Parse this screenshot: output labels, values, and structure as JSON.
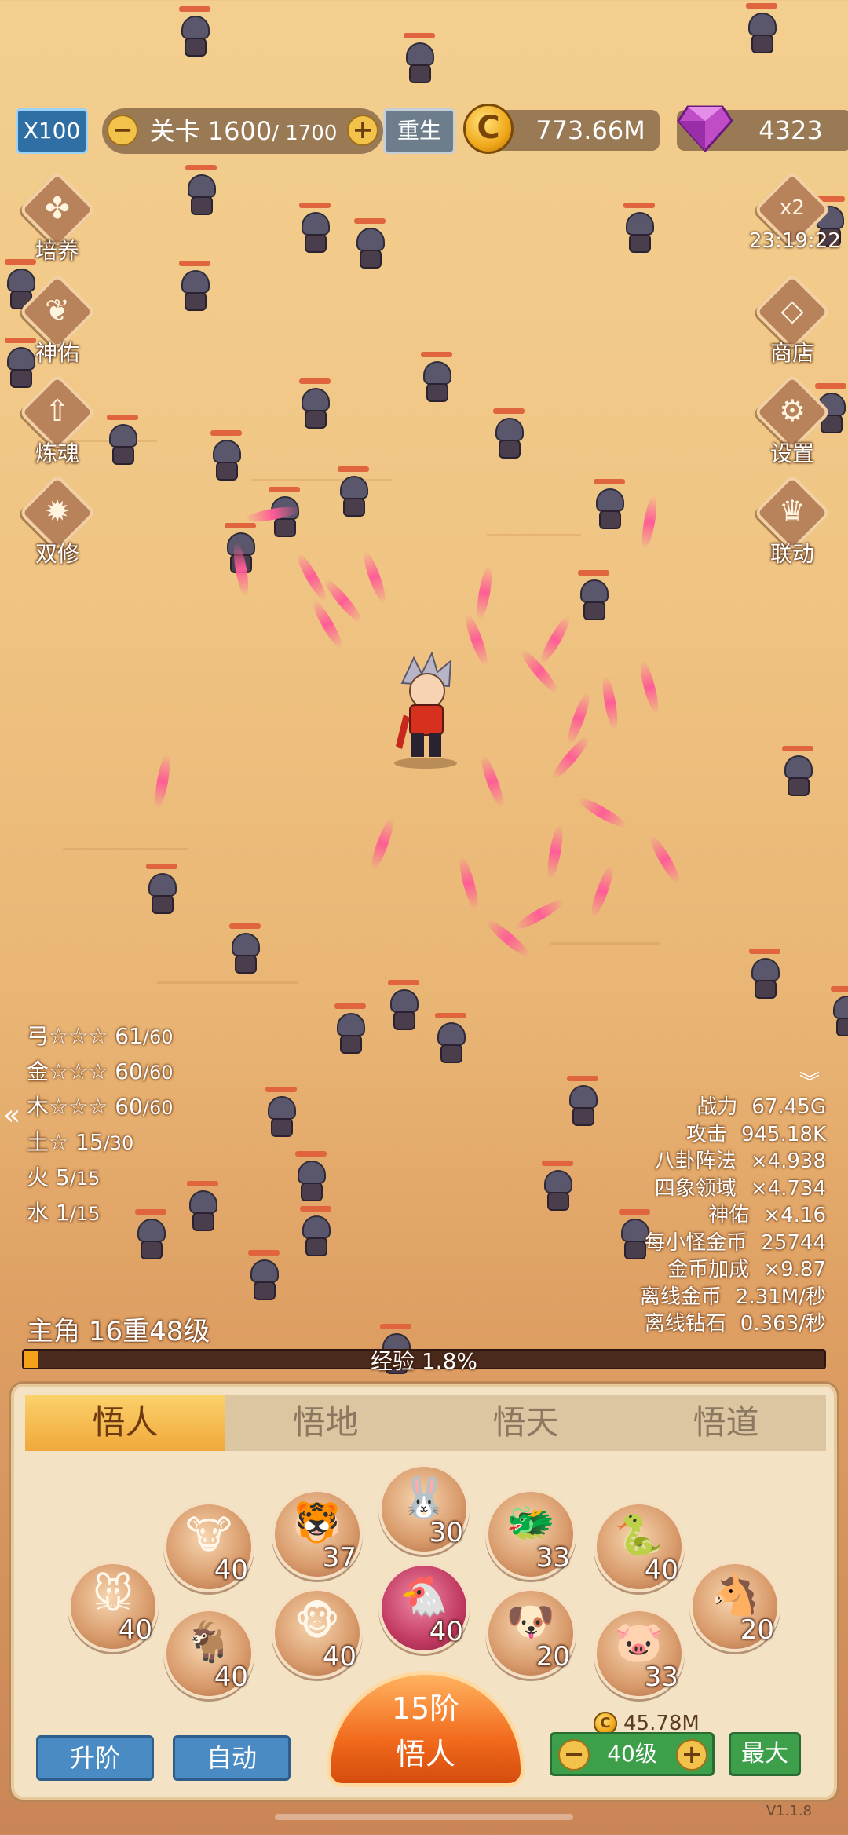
{
  "top": {
    "multiplier": "X100",
    "level_prefix": "关卡 ",
    "level_current": "1600",
    "level_total": "/ 1700",
    "minus": "−",
    "plus": "+",
    "rebirth": "重生",
    "gold": "773.66M",
    "coin_glyph": "C",
    "gems": "4323"
  },
  "left_menu": [
    {
      "label": "培养",
      "icon": "clover-icon",
      "glyph": "✤"
    },
    {
      "label": "神佑",
      "icon": "wings-icon",
      "glyph": "❦"
    },
    {
      "label": "炼魂",
      "icon": "up-arrow-icon",
      "glyph": "⇧"
    },
    {
      "label": "双修",
      "icon": "flame-icon",
      "glyph": "✹"
    }
  ],
  "right_menu": {
    "boost_label": "x2",
    "boost_timer": "23:19:22",
    "shop": "商店",
    "settings": "设置",
    "link": "联动"
  },
  "elements": [
    {
      "name": "弓☆☆☆",
      "value": "61",
      "max": "/60"
    },
    {
      "name": "金☆☆☆",
      "value": "60",
      "max": "/60"
    },
    {
      "name": "木☆☆☆",
      "value": "60",
      "max": "/60"
    },
    {
      "name": "土☆",
      "value": "15",
      "max": "/30"
    },
    {
      "name": "火",
      "value": "5",
      "max": "/15"
    },
    {
      "name": "水",
      "value": "1",
      "max": "/15"
    }
  ],
  "stats": [
    {
      "label": "战力",
      "value": "67.45G"
    },
    {
      "label": "攻击",
      "value": "945.18K"
    },
    {
      "label": "八卦阵法",
      "value": "×4.938"
    },
    {
      "label": "四象领域",
      "value": "×4.734"
    },
    {
      "label": "神佑",
      "value": "×4.16"
    },
    {
      "label": "每小怪金币",
      "value": "25744"
    },
    {
      "label": "金币加成",
      "value": "×9.87"
    },
    {
      "label": "离线金币",
      "value": "2.31M/秒"
    },
    {
      "label": "离线钻石",
      "value": "0.363/秒"
    }
  ],
  "hero": {
    "title": "主角 16重48级",
    "exp_text": "经验 1.8%",
    "exp_fraction": 0.018
  },
  "tabs": [
    "悟人",
    "悟地",
    "悟天",
    "悟道"
  ],
  "zodiac": [
    {
      "name": "rat-icon",
      "glyph": "🐭",
      "level": "40"
    },
    {
      "name": "ox-icon",
      "glyph": "🐮",
      "level": "40"
    },
    {
      "name": "tiger-icon",
      "glyph": "🐯",
      "level": "37"
    },
    {
      "name": "rabbit-icon",
      "glyph": "🐰",
      "level": "30"
    },
    {
      "name": "dragon-icon",
      "glyph": "🐲",
      "level": "33"
    },
    {
      "name": "snake-icon",
      "glyph": "🐍",
      "level": "40"
    },
    {
      "name": "horse-icon",
      "glyph": "🐴",
      "level": "20"
    },
    {
      "name": "goat-icon",
      "glyph": "🐐",
      "level": "40"
    },
    {
      "name": "monkey-icon",
      "glyph": "🐵",
      "level": "40"
    },
    {
      "name": "rooster-icon",
      "glyph": "🐔",
      "level": "40"
    },
    {
      "name": "dog-icon",
      "glyph": "🐶",
      "level": "20"
    },
    {
      "name": "pig-icon",
      "glyph": "🐷",
      "level": "33"
    }
  ],
  "bottom": {
    "upgrade": "升阶",
    "auto": "自动",
    "rank": "15阶",
    "rank_name": "悟人",
    "cost": "45.78M",
    "level": "40级",
    "max": "最大",
    "version": "V1.1.8"
  },
  "colors": {
    "accent_orange": "#f26a1c",
    "gold": "#f0a81a",
    "gem": "#c04cc8",
    "green": "#3e9f4b",
    "blue": "#4a8bc4"
  }
}
